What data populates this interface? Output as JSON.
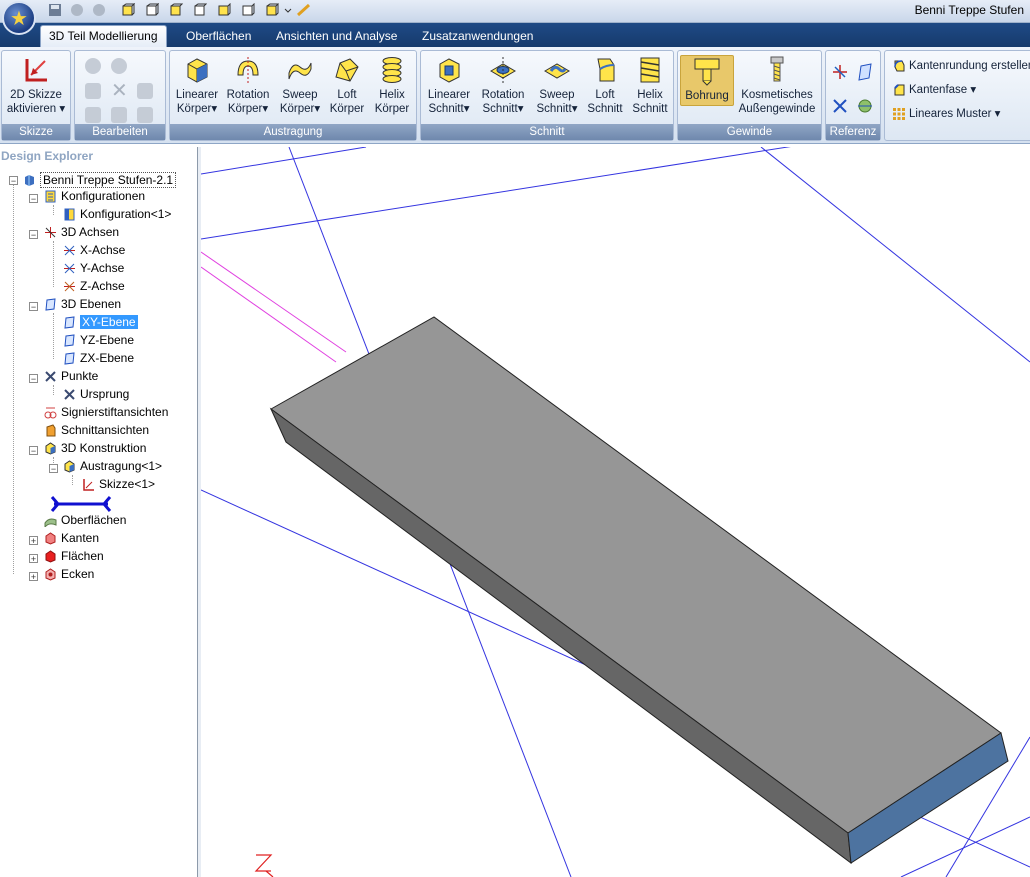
{
  "title": "Benni Treppe Stufen",
  "tabs": [
    "3D Teil Modellierung",
    "Oberflächen",
    "Ansichten und Analyse",
    "Zusatzanwendungen"
  ],
  "active_tab": 0,
  "ribbon": {
    "skizze": {
      "label": "Skizze",
      "button_line1": "2D Skizze",
      "button_line2": "aktivieren"
    },
    "bearbeiten": {
      "label": "Bearbeiten"
    },
    "austragung": {
      "label": "Austragung",
      "buttons": [
        {
          "line1": "Linearer",
          "line2": "Körper"
        },
        {
          "line1": "Rotation",
          "line2": "Körper"
        },
        {
          "line1": "Sweep",
          "line2": "Körper"
        },
        {
          "line1": "Loft",
          "line2": "Körper"
        },
        {
          "line1": "Helix",
          "line2": "Körper"
        }
      ]
    },
    "schnitt": {
      "label": "Schnitt",
      "buttons": [
        {
          "line1": "Linearer",
          "line2": "Schnitt"
        },
        {
          "line1": "Rotation",
          "line2": "Schnitt"
        },
        {
          "line1": "Sweep",
          "line2": "Schnitt"
        },
        {
          "line1": "Loft",
          "line2": "Schnitt"
        },
        {
          "line1": "Helix",
          "line2": "Schnitt"
        }
      ]
    },
    "gewinde": {
      "label": "Gewinde",
      "buttons": [
        {
          "line1": "Bohrung",
          "line2": ""
        },
        {
          "line1": "Kosmetisches",
          "line2": "Außengewinde"
        }
      ]
    },
    "referenz": {
      "label": "Referenz"
    },
    "extras": {
      "items": [
        "Kantenrundung erstellen",
        "Kantenfase",
        "Lineares Muster"
      ]
    }
  },
  "explorer": {
    "title": "Design Explorer",
    "root": "Benni Treppe Stufen-2.1",
    "items": {
      "konfigurationen": "Konfigurationen",
      "konfiguration1": "Konfiguration<1>",
      "achsen": "3D Achsen",
      "x_achse": "X-Achse",
      "y_achse": "Y-Achse",
      "z_achse": "Z-Achse",
      "ebenen": "3D Ebenen",
      "xy": "XY-Ebene",
      "yz": "YZ-Ebene",
      "zx": "ZX-Ebene",
      "punkte": "Punkte",
      "ursprung": "Ursprung",
      "signier": "Signierstiftansichten",
      "schnittansichten": "Schnittansichten",
      "konstruktion": "3D Konstruktion",
      "austragung1": "Austragung<1>",
      "skizze1": "Skizze<1>",
      "oberflaechen": "Oberflächen",
      "kanten": "Kanten",
      "flaechen": "Flächen",
      "ecken": "Ecken"
    }
  },
  "viewport": {
    "axis_label": "Z"
  },
  "colors": {
    "tab_bar": "#1f4a86",
    "selection": "#3399ff",
    "solid_top": "#969696",
    "solid_end": "#4d73a0"
  }
}
